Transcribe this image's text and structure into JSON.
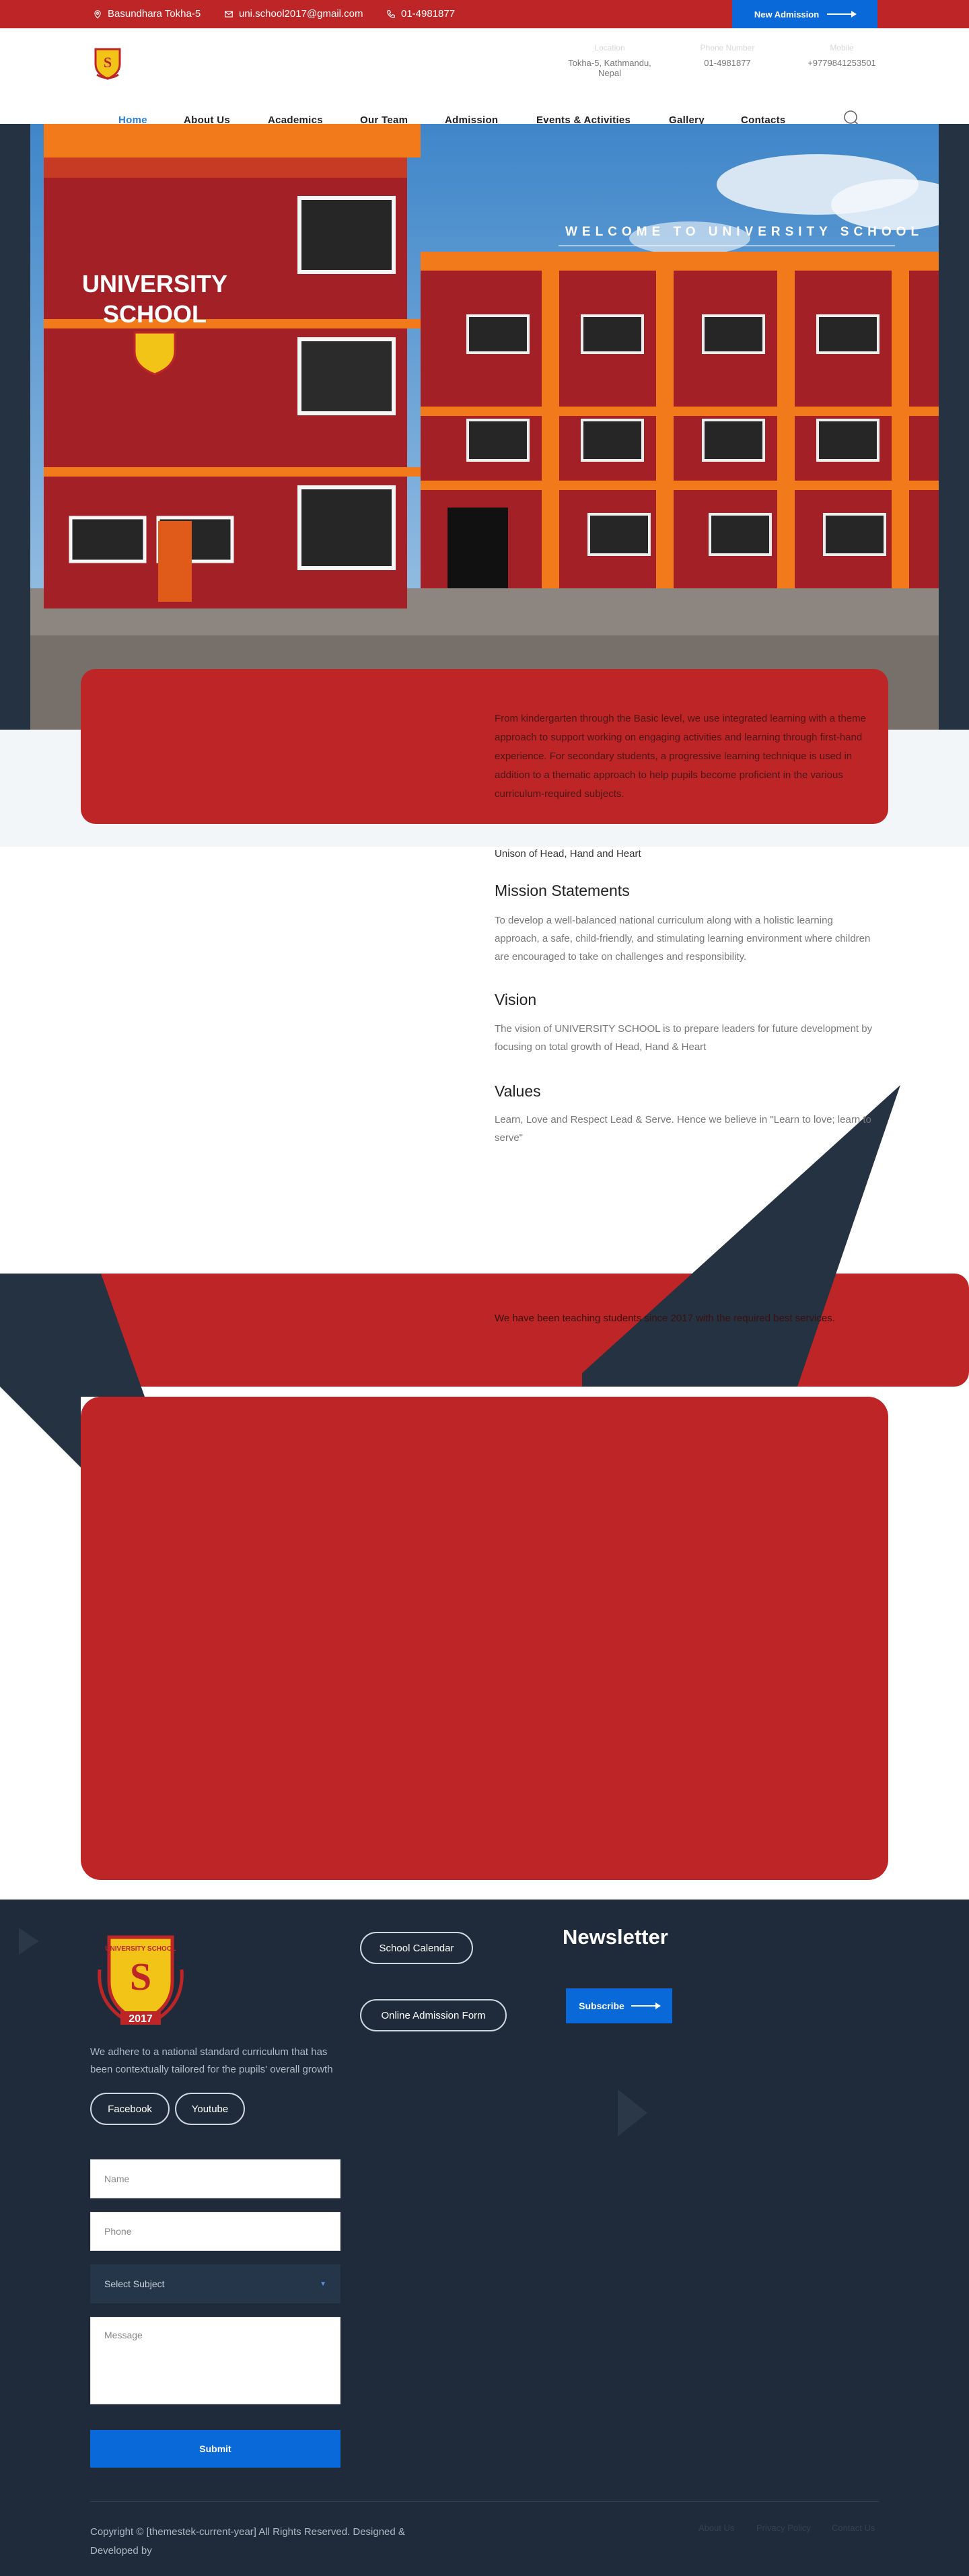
{
  "topbar": {
    "address": "Basundhara Tokha-5",
    "email": "uni.school2017@gmail.com",
    "phone": "01-4981877",
    "new_admission": "New Admission"
  },
  "header": {
    "contacts": [
      {
        "label": "Location",
        "value": "Tokha-5, Kathmandu, Nepal"
      },
      {
        "label": "Phone Number",
        "value": "01-4981877"
      },
      {
        "label": "Mobile",
        "value": "+9779841253501"
      }
    ],
    "nav": [
      "Home",
      "About Us",
      "Academics",
      "Our Team",
      "Admission",
      "Events & Activities",
      "Gallery",
      "Contacts"
    ],
    "active_nav": "Home"
  },
  "hero": {
    "title": "WELCOME TO UNIVERSITY SCHOOL",
    "building_sign_line1": "UNIVERSITY",
    "building_sign_line2": "SCHOOL"
  },
  "intro": {
    "text": "From kindergarten through the Basic level, we use integrated learning with a theme approach to support working on engaging activities and learning through first-hand experience. For secondary students, a progressive learning technique is used in addition to a thematic approach to help pupils become proficient in the various curriculum-required subjects."
  },
  "about": {
    "tagline": "Unison of Head, Hand and Heart",
    "mission_title": "Mission Statements",
    "mission_body": "To develop a well-balanced national curriculum along with a holistic learning approach, a safe, child-friendly, and stimulating learning environment where children are encouraged to take on challenges and responsibility.",
    "vision_title": "Vision",
    "vision_body": "The vision of UNIVERSITY SCHOOL is to prepare leaders for future development by focusing on total growth of Head, Hand & Heart",
    "values_title": "Values",
    "values_body": "Learn, Love and Respect Lead & Serve. Hence we believe in \"Learn to love; learn to serve\""
  },
  "band": {
    "text": "We have been teaching students since 2017 with the required best services."
  },
  "footer": {
    "description": "We adhere to a national standard curriculum that has been contextually tailored for the pupils' overall growth",
    "social": [
      "Facebook",
      "Youtube"
    ],
    "links": [
      "School Calendar",
      "Online Admission Form"
    ],
    "newsletter_title": "Newsletter",
    "subscribe": "Subscribe",
    "form": {
      "name": "Name",
      "phone": "Phone",
      "subject": "Select Subject",
      "message": "Message",
      "submit": "Submit"
    },
    "copyright": "Copyright © [themestek-current-year] All Rights Reserved. Designed & Developed by",
    "bottom_links": [
      "About Us",
      "Privacy Policy",
      "Contact Us"
    ],
    "logo_year": "2017",
    "logo_text": "UNIVERSITY SCHOOL"
  },
  "colors": {
    "brand_red": "#bd2526",
    "accent_blue": "#0a69d9",
    "dark_navy": "#1f2b3a"
  }
}
